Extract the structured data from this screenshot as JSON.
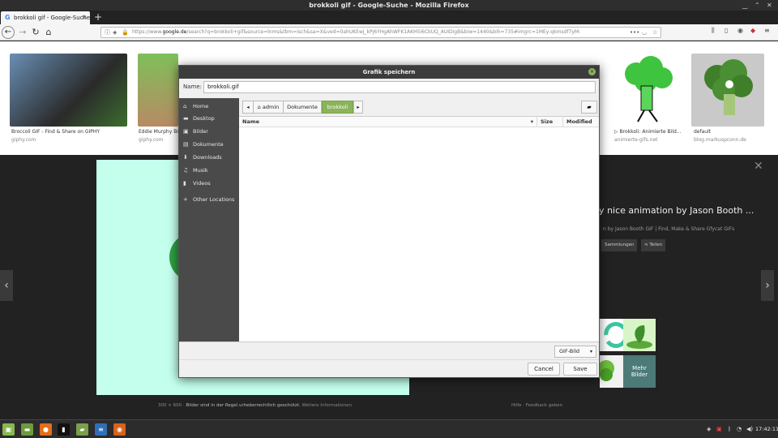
{
  "window": {
    "title": "brokkoli gif - Google-Suche - Mozilla Firefox"
  },
  "browser": {
    "tab_title": "brokkoli gif - Google-Suche",
    "tab_favicon": "G",
    "url_prefix": "https://www.",
    "url_host": "google.de",
    "url_rest": "/search?q=brokkoli+gif&source=lnms&tbm=isch&sa=X&ved=0ahUKEwj_kPj6YHgAhWFK1AKHSi6CkUQ_AUIDigB&biw=1440&bih=735#imgrc=1MEy-qkmsdf7yM:"
  },
  "results": [
    {
      "caption": "Broccoli GIF - Find & Share on GIPHY",
      "source": "giphy.com"
    },
    {
      "caption": "Eddie Murphy Bro",
      "source": "giphy.com"
    },
    {
      "caption": "▷ Brokkoli: Animierte Bild...",
      "source": "animierte-gifs.net"
    },
    {
      "caption": "default",
      "source": "blog.markuspconn.de"
    }
  ],
  "viewer": {
    "title": "ly nice animation by Jason Booth ...",
    "subtitle": "n by Jason Booth GIF | Find, Make & Share Gfycat GIFs",
    "buttons": [
      "Sammlungen",
      "Teilen"
    ],
    "more_images": "Mehr Bilder",
    "size_text": "300 × 600",
    "rights_text": "Bilder sind in der Regel urheberrechtlich geschützt.",
    "more_info": "Weitere Informationen",
    "help": "Hilfe",
    "feedback": "Feedback geben"
  },
  "dialog": {
    "title": "Grafik speichern",
    "name_label": "Name:",
    "name_value": "brokkoli.gif",
    "sidebar": [
      {
        "label": "Home",
        "icon": "home-icon",
        "glyph": "⌂"
      },
      {
        "label": "Desktop",
        "icon": "desktop-icon",
        "glyph": "▬"
      },
      {
        "label": "Bilder",
        "icon": "pictures-icon",
        "glyph": "▣"
      },
      {
        "label": "Dokumente",
        "icon": "documents-icon",
        "glyph": "▤"
      },
      {
        "label": "Downloads",
        "icon": "download-icon",
        "glyph": "⬇"
      },
      {
        "label": "Musik",
        "icon": "music-icon",
        "glyph": "♫"
      },
      {
        "label": "Videos",
        "icon": "video-icon",
        "glyph": "▮"
      },
      {
        "label": "Other Locations",
        "icon": "plus-icon",
        "glyph": "+"
      }
    ],
    "path": [
      "admin",
      "Dokumente",
      "brokkoli"
    ],
    "columns": {
      "name": "Name",
      "size": "Size",
      "modified": "Modified"
    },
    "filter": "GIF-Bild",
    "cancel": "Cancel",
    "save": "Save"
  },
  "taskbar": {
    "clock": "17:42:11"
  },
  "colors": {
    "accent": "#8bb35a",
    "dialog_sidebar": "#4a4a4a",
    "viewer_bg": "#222222",
    "big_image_bg": "#c4ffee"
  }
}
